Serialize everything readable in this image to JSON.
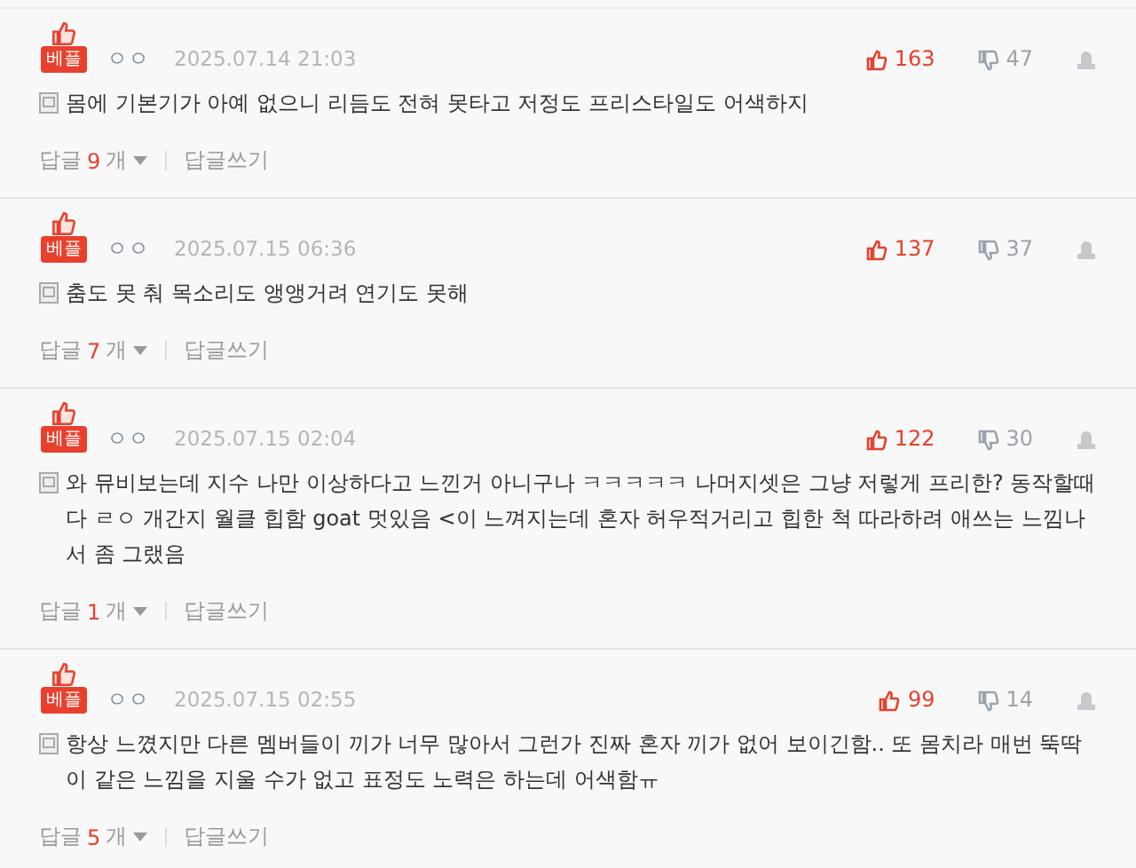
{
  "comments": [
    {
      "badge": "베플",
      "nickname": "ㅇㅇ",
      "date": "2025.07.14 21:03",
      "likes": "163",
      "dislikes": "47",
      "text": "몸에 기본기가 아예 없으니 리듬도 전혀 못타고 저정도 프리스타일도 어색하지",
      "reply_label": "답글",
      "reply_count": "9",
      "reply_unit": "개",
      "write_reply": "답글쓰기"
    },
    {
      "badge": "베플",
      "nickname": "ㅇㅇ",
      "date": "2025.07.15 06:36",
      "likes": "137",
      "dislikes": "37",
      "text": "춤도 못 춰 목소리도 앵앵거려 연기도 못해",
      "reply_label": "답글",
      "reply_count": "7",
      "reply_unit": "개",
      "write_reply": "답글쓰기"
    },
    {
      "badge": "베플",
      "nickname": "ㅇㅇ",
      "date": "2025.07.15 02:04",
      "likes": "122",
      "dislikes": "30",
      "text": "와 뮤비보는데 지수 나만 이상하다고 느낀거 아니구나 ㅋㅋㅋㅋㅋ 나머지셋은 그냥 저렇게 프리한? 동작할때 다 ㄹㅇ 개간지 월클 힙함 goat 멋있음 <이 느껴지는데 혼자 허우적거리고 힙한 척 따라하려 애쓰는 느낌나서 좀 그랬음",
      "reply_label": "답글",
      "reply_count": "1",
      "reply_unit": "개",
      "write_reply": "답글쓰기"
    },
    {
      "badge": "베플",
      "nickname": "ㅇㅇ",
      "date": "2025.07.15 02:55",
      "likes": "99",
      "dislikes": "14",
      "text": "항상 느꼈지만 다른 멤버들이 끼가 너무 많아서 그런가 진짜 혼자 끼가 없어 보이긴함.. 또 몸치라 매번 뚝딱이 같은 느낌을 지울 수가 없고 표정도 노력은 하는데 어색함ㅠ",
      "reply_label": "답글",
      "reply_count": "5",
      "reply_unit": "개",
      "write_reply": "답글쓰기"
    }
  ]
}
